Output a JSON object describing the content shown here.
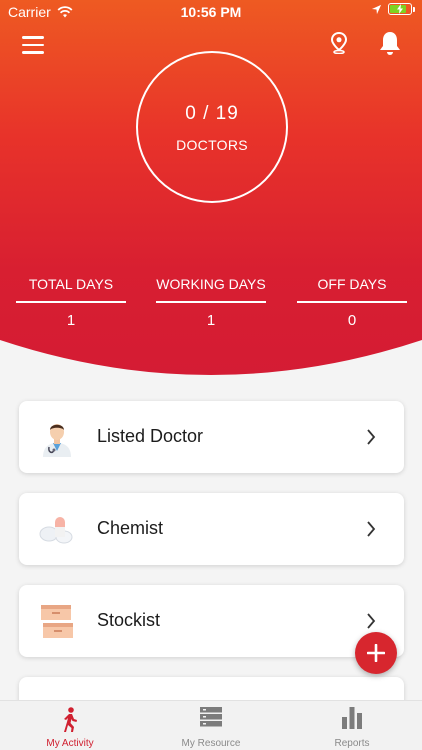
{
  "status_bar": {
    "carrier": "Carrier",
    "time": "10:56 PM"
  },
  "header": {
    "menu_icon": "hamburger-menu-icon",
    "location_icon": "location-pin-icon",
    "notification_icon": "bell-icon",
    "doctor_count": "0 / 19",
    "doctor_label": "DOCTORS"
  },
  "stats": [
    {
      "title": "TOTAL DAYS",
      "value": "1"
    },
    {
      "title": "WORKING DAYS",
      "value": "1"
    },
    {
      "title": "OFF DAYS",
      "value": "0"
    }
  ],
  "cards": [
    {
      "label": "Listed Doctor",
      "icon": "doctor-icon"
    },
    {
      "label": "Chemist",
      "icon": "pills-icon"
    },
    {
      "label": "Stockist",
      "icon": "boxes-icon"
    }
  ],
  "fab_icon": "plus-icon",
  "tabs": [
    {
      "label": "My Activity",
      "icon": "running-person-icon",
      "active": true
    },
    {
      "label": "My Resource",
      "icon": "server-stack-icon",
      "active": false
    },
    {
      "label": "Reports",
      "icon": "bar-chart-icon",
      "active": false
    }
  ],
  "colors": {
    "accent": "#d7262e",
    "gradient_top": "#ee5a22",
    "gradient_bottom": "#d41b34",
    "battery": "#7ed321"
  }
}
